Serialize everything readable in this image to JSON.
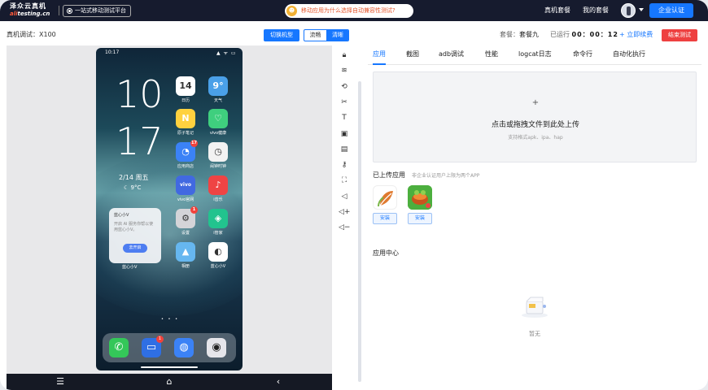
{
  "brand": {
    "cn_name": "泽众云真机",
    "domain_prefix": "ali",
    "domain_rest": "testing.cn"
  },
  "header": {
    "platform_label": "一站式移动测试平台",
    "promo_text": "移动应用为什么选择自动兼容性测试?",
    "nav_real_plan": "真机套餐",
    "nav_my_plan": "我的套餐",
    "enterprise_button": "企业认证"
  },
  "session": {
    "device_label": "真机调试：X100",
    "switch_button": "切换机型",
    "quality_smooth": "流畅",
    "quality_clear": "清晰",
    "plan_label": "套餐：",
    "plan_value": "套餐九",
    "runtime_label": "已运行",
    "runtime_value": "00：00：12",
    "renew_link": "+ 立即续费",
    "end_test_button": "结束测试"
  },
  "phone": {
    "status_time": "10:17",
    "status_icons": "▲ ᯤ ▭",
    "clock_hour": "10",
    "clock_minute": "17",
    "date": "2/14 周五",
    "weather": "☾ 9°C",
    "apps": [
      {
        "name": "日历",
        "color": "#ffffff",
        "glyph": "14"
      },
      {
        "name": "天气",
        "color": "#4aa0e8",
        "glyph": "9°"
      },
      {
        "name": "原子笔记",
        "color": "#ffd23f",
        "glyph": "N"
      },
      {
        "name": "vivo健康",
        "color": "#3fcf7e",
        "glyph": "♡"
      },
      {
        "name": "应用商店",
        "color": "#3b82f6",
        "glyph": "◔",
        "badge": "17"
      },
      {
        "name": "闹钟时钟",
        "color": "#f2f2f2",
        "glyph": "◷"
      },
      {
        "name": "vivo官网",
        "color": "#4169e1",
        "glyph": "vivo"
      },
      {
        "name": "i音乐",
        "color": "#ef4444",
        "glyph": "♪"
      },
      {
        "name": "设置",
        "color": "#d4d4d8",
        "glyph": "⚙",
        "badge": "1"
      },
      {
        "name": "i管家",
        "color": "#22c38e",
        "glyph": "◈"
      },
      {
        "name": "相册",
        "color": "#66b7f0",
        "glyph": "▲"
      },
      {
        "name": "蓝心小V",
        "color": "#ffffff",
        "glyph": "◐"
      }
    ],
    "card_title": "蓝心小V",
    "card_desc": "开启 AI 服务你帮以使用蓝心小V。",
    "card_button": "去开启",
    "card_name": "蓝心小V",
    "dock": [
      {
        "name": "phone",
        "color": "#34c759",
        "glyph": "✆"
      },
      {
        "name": "messages",
        "color": "#2f6fe4",
        "glyph": "▭",
        "badge": "1"
      },
      {
        "name": "browser",
        "color": "#3b82f6",
        "glyph": "◍"
      },
      {
        "name": "camera",
        "color": "#e5e5ea",
        "glyph": "◉"
      }
    ],
    "nav_menu": "☰",
    "nav_home": "⌂",
    "nav_back": "‹"
  },
  "tools": [
    "lock-icon",
    "wifi-icon",
    "rotate-icon",
    "scissors-icon",
    "text-icon",
    "image-icon",
    "image-edit-icon",
    "key-icon",
    "fullscreen-icon",
    "volume-icon",
    "volume-up-icon",
    "volume-down-icon"
  ],
  "tabs": [
    "应用",
    "截图",
    "adb调试",
    "性能",
    "logcat日志",
    "命令行",
    "自动化执行"
  ],
  "upload": {
    "plus": "+",
    "main": "点击或拖拽文件到此处上传",
    "hint": "支持格式apk、ipa、hap"
  },
  "uploaded": {
    "title": "已上传应用",
    "note": "非企业认证用户上限为两个APP",
    "install_label": "安装"
  },
  "app_center": {
    "title": "应用中心",
    "empty": "暂无"
  }
}
